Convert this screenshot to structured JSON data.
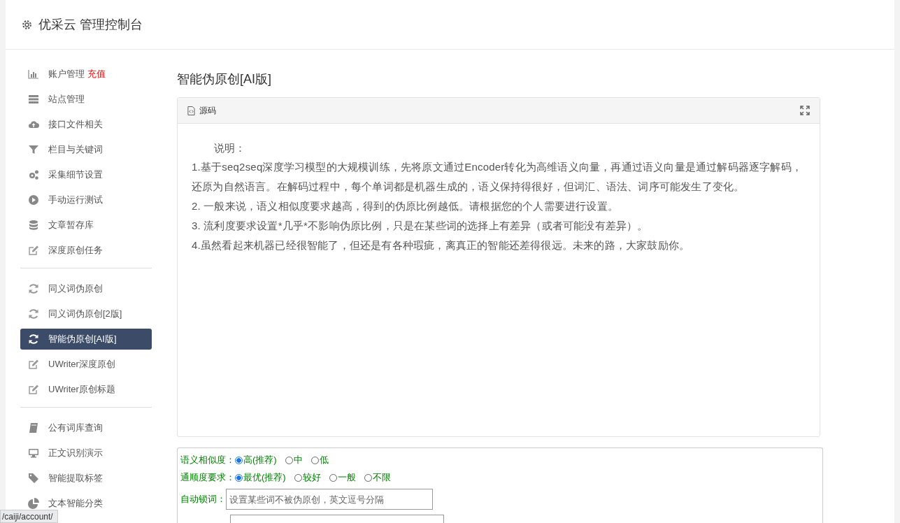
{
  "header": {
    "title": "优采云 管理控制台"
  },
  "sidebar": {
    "groups": [
      {
        "items": [
          {
            "label": "账户管理",
            "badge": "充值",
            "selected": false
          },
          {
            "label": "站点管理",
            "selected": false
          },
          {
            "label": "接口文件相关",
            "selected": false
          },
          {
            "label": "栏目与关键词",
            "selected": false
          },
          {
            "label": "采集细节设置",
            "selected": false
          },
          {
            "label": "手动运行测试",
            "selected": false
          },
          {
            "label": "文章暂存库",
            "selected": false
          },
          {
            "label": "深度原创任务",
            "selected": false
          }
        ]
      },
      {
        "items": [
          {
            "label": "同义词伪原创",
            "selected": false
          },
          {
            "label": "同义词伪原创[2版]",
            "selected": false
          },
          {
            "label": "智能伪原创[AI版]",
            "selected": true
          },
          {
            "label": "UWriter深度原创",
            "selected": false
          },
          {
            "label": "UWriter原创标题",
            "selected": false
          }
        ]
      },
      {
        "items": [
          {
            "label": "公有词库查询",
            "selected": false
          },
          {
            "label": "正文识别演示",
            "selected": false
          },
          {
            "label": "智能提取标签",
            "selected": false
          },
          {
            "label": "文本智能分类",
            "selected": false
          }
        ]
      }
    ]
  },
  "page_title": "智能伪原创[AI版]",
  "editor": {
    "toolbar_label": "源码",
    "lines": [
      "说明：",
      "1.基于seq2seq深度学习模型的大规模训练，先将原文通过Encoder转化为高维语义向量，再通过语义向量是通过解码器逐字解码，还原为自然语言。在解码过程中，每个单词都是机器生成的，语义保持得很好，但词汇、语法、词序可能发生了变化。",
      "2. 一般来说，语义相似度要求越高，得到的伪原比例越低。请根据您的个人需要进行设置。",
      "3. 流利度要求设置*几乎*不影响伪原比例，只是在某些词的选择上有差异（或者可能没有差异）。",
      "4.虽然看起来机器已经很智能了，但还是有各种瑕疵，离真正的智能还差得很远。未来的路，大家鼓励你。"
    ]
  },
  "form": {
    "radio_groups": [
      {
        "label": "语义相似度：",
        "options": [
          {
            "label": "高(推荐)",
            "selected": true
          },
          {
            "label": "中",
            "selected": false
          },
          {
            "label": "低",
            "selected": false
          }
        ]
      },
      {
        "label": "通顺度要求：",
        "options": [
          {
            "label": "最优(推荐)",
            "selected": true
          },
          {
            "label": "较好",
            "selected": false
          },
          {
            "label": "一般",
            "selected": false
          },
          {
            "label": "不限",
            "selected": false
          }
        ]
      }
    ],
    "lock_words": {
      "label": "自动锁词：",
      "placeholder": "设置某些词不被伪原创，英文逗号分隔"
    }
  },
  "status_url": "/caiji/account/"
}
